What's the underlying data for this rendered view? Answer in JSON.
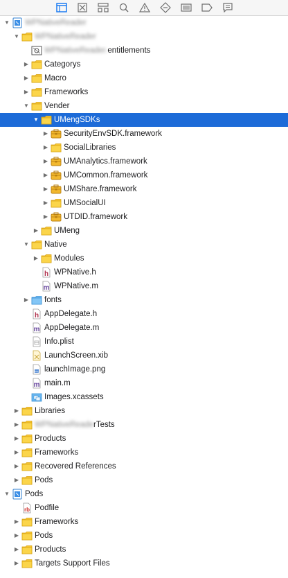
{
  "toolbar": {
    "buttons": [
      {
        "name": "project-navigator-icon",
        "active": true
      },
      {
        "name": "source-control-icon",
        "active": false
      },
      {
        "name": "symbol-navigator-icon",
        "active": false
      },
      {
        "name": "find-navigator-icon",
        "active": false
      },
      {
        "name": "issue-navigator-icon",
        "active": false
      },
      {
        "name": "test-navigator-icon",
        "active": false
      },
      {
        "name": "debug-navigator-icon",
        "active": false
      },
      {
        "name": "breakpoint-navigator-icon",
        "active": false
      },
      {
        "name": "report-navigator-icon",
        "active": false
      }
    ]
  },
  "tree": [
    {
      "label": "WPNativeReader",
      "blurred": true,
      "icon": "project",
      "level": 0,
      "disclosure": "open"
    },
    {
      "label": "WPNativeReader",
      "blurred": true,
      "icon": "folder",
      "level": 1,
      "disclosure": "open"
    },
    {
      "label": "WPNativeReader.entitlements",
      "blurred_prefix": "WPNativeReader.",
      "visible_suffix": "entitlements",
      "icon": "entitlements",
      "level": 2,
      "disclosure": "none"
    },
    {
      "label": "Categorys",
      "icon": "folder",
      "level": 2,
      "disclosure": "closed"
    },
    {
      "label": "Macro",
      "icon": "folder",
      "level": 2,
      "disclosure": "closed"
    },
    {
      "label": "Frameworks",
      "icon": "folder",
      "level": 2,
      "disclosure": "closed"
    },
    {
      "label": "Vender",
      "icon": "folder",
      "level": 2,
      "disclosure": "open"
    },
    {
      "label": "UMengSDKs",
      "icon": "folder",
      "level": 3,
      "disclosure": "open",
      "selected": true
    },
    {
      "label": "SecurityEnvSDK.framework",
      "icon": "framework",
      "level": 4,
      "disclosure": "closed"
    },
    {
      "label": "SocialLibraries",
      "icon": "folder",
      "level": 4,
      "disclosure": "closed"
    },
    {
      "label": "UMAnalytics.framework",
      "icon": "framework",
      "level": 4,
      "disclosure": "closed"
    },
    {
      "label": "UMCommon.framework",
      "icon": "framework",
      "level": 4,
      "disclosure": "closed"
    },
    {
      "label": "UMShare.framework",
      "icon": "framework",
      "level": 4,
      "disclosure": "closed"
    },
    {
      "label": "UMSocialUI",
      "icon": "folder",
      "level": 4,
      "disclosure": "closed"
    },
    {
      "label": "UTDID.framework",
      "icon": "framework",
      "level": 4,
      "disclosure": "closed"
    },
    {
      "label": "UMeng",
      "icon": "folder",
      "level": 3,
      "disclosure": "closed"
    },
    {
      "label": "Native",
      "icon": "folder",
      "level": 2,
      "disclosure": "open"
    },
    {
      "label": "Modules",
      "icon": "folder",
      "level": 3,
      "disclosure": "closed"
    },
    {
      "label": "WPNative.h",
      "icon": "header",
      "level": 3,
      "disclosure": "none"
    },
    {
      "label": "WPNative.m",
      "icon": "objc",
      "level": 3,
      "disclosure": "none"
    },
    {
      "label": "fonts",
      "icon": "folder-blue",
      "level": 2,
      "disclosure": "closed"
    },
    {
      "label": "AppDelegate.h",
      "icon": "header",
      "level": 2,
      "disclosure": "none"
    },
    {
      "label": "AppDelegate.m",
      "icon": "objc",
      "level": 2,
      "disclosure": "none"
    },
    {
      "label": "Info.plist",
      "icon": "plist",
      "level": 2,
      "disclosure": "none"
    },
    {
      "label": "LaunchScreen.xib",
      "icon": "xib",
      "level": 2,
      "disclosure": "none"
    },
    {
      "label": "launchImage.png",
      "icon": "png",
      "level": 2,
      "disclosure": "none"
    },
    {
      "label": "main.m",
      "icon": "objc",
      "level": 2,
      "disclosure": "none"
    },
    {
      "label": "Images.xcassets",
      "icon": "xcassets",
      "level": 2,
      "disclosure": "none"
    },
    {
      "label": "Libraries",
      "icon": "folder",
      "level": 1,
      "disclosure": "closed"
    },
    {
      "label": "WPNativeReaderTests",
      "blurred_prefix": "WPNativeReade",
      "visible_suffix": "rTests",
      "icon": "folder",
      "level": 1,
      "disclosure": "closed"
    },
    {
      "label": "Products",
      "icon": "folder",
      "level": 1,
      "disclosure": "closed"
    },
    {
      "label": "Frameworks",
      "icon": "folder",
      "level": 1,
      "disclosure": "closed"
    },
    {
      "label": "Recovered References",
      "icon": "folder",
      "level": 1,
      "disclosure": "closed"
    },
    {
      "label": "Pods",
      "icon": "folder",
      "level": 1,
      "disclosure": "closed"
    },
    {
      "label": "Pods",
      "icon": "project",
      "level": 0,
      "disclosure": "open"
    },
    {
      "label": "Podfile",
      "icon": "podfile",
      "level": 1,
      "disclosure": "none"
    },
    {
      "label": "Frameworks",
      "icon": "folder",
      "level": 1,
      "disclosure": "closed"
    },
    {
      "label": "Pods",
      "icon": "folder",
      "level": 1,
      "disclosure": "closed"
    },
    {
      "label": "Products",
      "icon": "folder",
      "level": 1,
      "disclosure": "closed"
    },
    {
      "label": "Targets Support Files",
      "icon": "folder",
      "level": 1,
      "disclosure": "closed"
    }
  ],
  "colors": {
    "selection": "#1d6bd8",
    "folder": "#f7c531",
    "folder_blue": "#6ab7f0",
    "toolbar_active": "#1b7cf2"
  }
}
